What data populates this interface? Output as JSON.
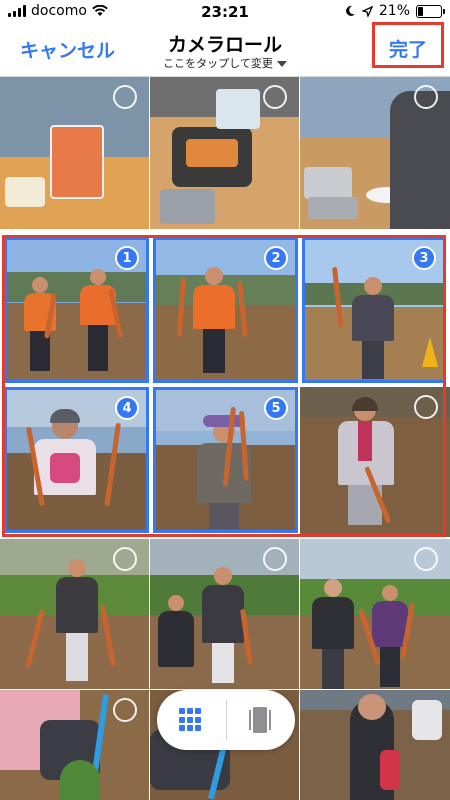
{
  "status_bar": {
    "carrier": "docomo",
    "time": "23:21",
    "battery": "21%"
  },
  "nav": {
    "cancel_label": "キャンセル",
    "title": "カメラロール",
    "subtitle": "ここをタップして変更",
    "done_label": "完了"
  },
  "photos": [
    {
      "selected": false,
      "badge": ""
    },
    {
      "selected": false,
      "badge": ""
    },
    {
      "selected": false,
      "badge": ""
    },
    {
      "selected": true,
      "badge": "1"
    },
    {
      "selected": true,
      "badge": "2"
    },
    {
      "selected": true,
      "badge": "3"
    },
    {
      "selected": true,
      "badge": "4"
    },
    {
      "selected": true,
      "badge": "5"
    },
    {
      "selected": false,
      "badge": ""
    },
    {
      "selected": false,
      "badge": ""
    },
    {
      "selected": false,
      "badge": ""
    },
    {
      "selected": false,
      "badge": ""
    },
    {
      "selected": false,
      "badge": ""
    },
    {
      "selected": false,
      "badge": ""
    },
    {
      "selected": false,
      "badge": ""
    }
  ],
  "view_toggle": {
    "grid_icon": "grid-icon",
    "single_icon": "single-photo-icon",
    "active": "grid"
  },
  "colors": {
    "accent": "#3478f6",
    "highlight": "#e53b2c"
  }
}
